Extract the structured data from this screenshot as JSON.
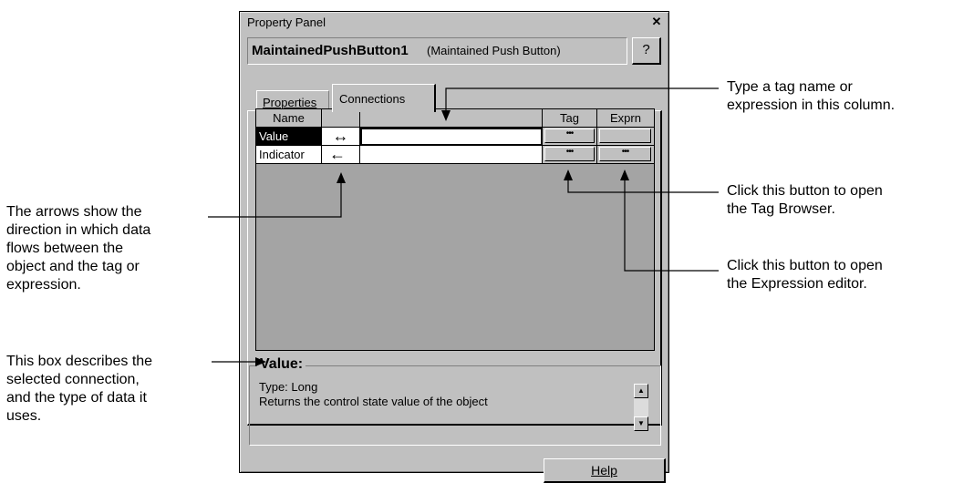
{
  "window": {
    "title": "Property Panel",
    "close_glyph": "✕",
    "object_name": "MaintainedPushButton1",
    "object_type": "(Maintained Push Button)",
    "help_q": "?"
  },
  "tabs": [
    {
      "label": "Properties",
      "active": false
    },
    {
      "label": "Connections",
      "active": true
    }
  ],
  "grid": {
    "columns": [
      "Name",
      "",
      "",
      "Tag",
      "Exprn"
    ],
    "rows": [
      {
        "name": "Value",
        "arrow": "↔",
        "expression": "",
        "tag_button": "•••",
        "exprn_button": "",
        "selected": true
      },
      {
        "name": "Indicator",
        "arrow": "←",
        "expression": "",
        "tag_button": "•••",
        "exprn_button": "•••",
        "selected": false
      }
    ]
  },
  "description": {
    "title": "Value:",
    "type_line": "Type: Long",
    "text": "Returns the control state value of the object"
  },
  "help_button": "Help",
  "annotations": {
    "tag_column": [
      "Type a tag name or",
      "expression in this column."
    ],
    "tag_browser": [
      "Click this button to open",
      "the Tag Browser."
    ],
    "expression_editor": [
      "Click this button to open",
      "the Expression editor."
    ],
    "arrows": [
      "The arrows show the",
      "direction in which data",
      "flows between the",
      "object and the tag or",
      "expression."
    ],
    "description_box": [
      "This box describes the",
      "selected connection,",
      "and the type of data it",
      "uses."
    ]
  },
  "colors": {
    "window_bg": "#c0c0c0",
    "grid_bg": "#a4a4a4",
    "selected_row": "#000000"
  }
}
